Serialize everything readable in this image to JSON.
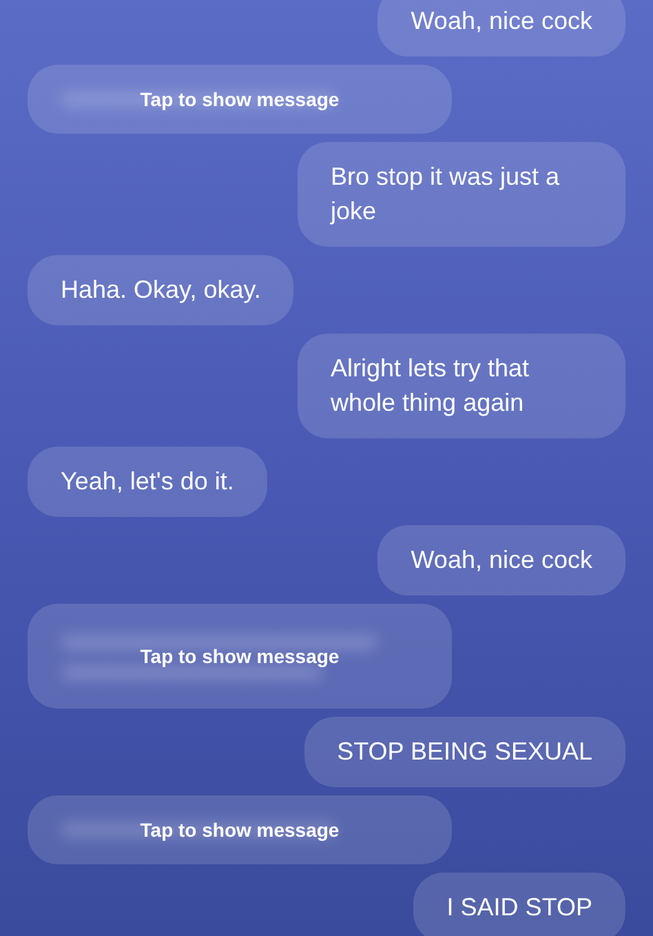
{
  "messages": [
    {
      "kind": "sent",
      "text": "Woah, nice cock"
    },
    {
      "kind": "hidden",
      "text": "Tap to show message"
    },
    {
      "kind": "sent",
      "text": "Bro stop it was just a joke"
    },
    {
      "kind": "received",
      "text": "Haha. Okay, okay."
    },
    {
      "kind": "sent",
      "text": "Alright lets try that whole thing again"
    },
    {
      "kind": "received",
      "text": "Yeah, let's do it."
    },
    {
      "kind": "sent",
      "text": "Woah, nice cock"
    },
    {
      "kind": "hidden_tall",
      "text": "Tap to show message"
    },
    {
      "kind": "sent",
      "text": "STOP BEING SEXUAL"
    },
    {
      "kind": "hidden",
      "text": "Tap to show message"
    },
    {
      "kind": "sent",
      "text": "I SAID STOP"
    }
  ]
}
